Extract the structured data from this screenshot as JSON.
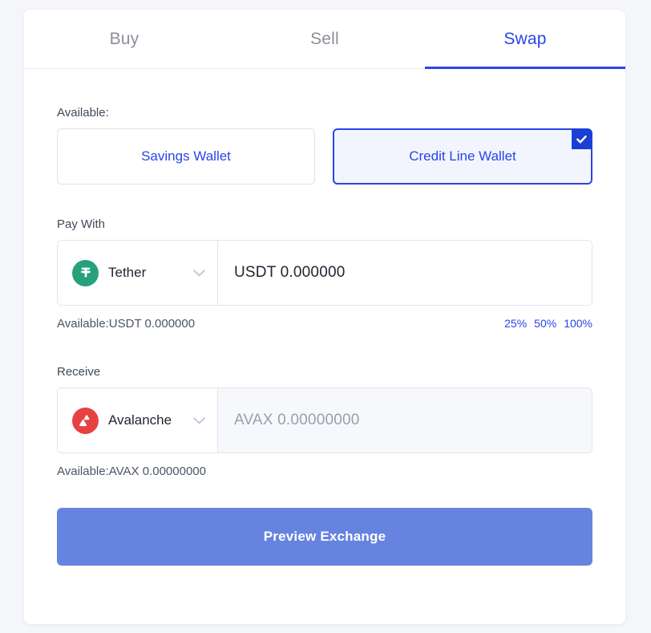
{
  "tabs": [
    {
      "label": "Buy",
      "active": false
    },
    {
      "label": "Sell",
      "active": false
    },
    {
      "label": "Swap",
      "active": true
    }
  ],
  "available_section": {
    "label": "Available:",
    "wallets": [
      {
        "label": "Savings Wallet",
        "selected": false
      },
      {
        "label": "Credit Line Wallet",
        "selected": true
      }
    ]
  },
  "pay_with": {
    "label": "Pay With",
    "coin": {
      "name": "Tether",
      "symbol": "USDT",
      "icon": "tether-icon",
      "color": "#26a17b"
    },
    "amount_value": "USDT 0.000000",
    "amount_placeholder": "USDT 0.000000",
    "balance_text": "Available:USDT 0.000000",
    "percents": [
      "25%",
      "50%",
      "100%"
    ]
  },
  "receive": {
    "label": "Receive",
    "coin": {
      "name": "Avalanche",
      "symbol": "AVAX",
      "icon": "avalanche-icon",
      "color": "#e84142"
    },
    "amount_value": "",
    "amount_placeholder": "AVAX 0.00000000",
    "balance_text": "Available:AVAX 0.00000000"
  },
  "submit": {
    "label": "Preview Exchange",
    "color": "#6683e0"
  },
  "theme": {
    "accent": "#2945e6",
    "page_bg": "#f4f6fa",
    "card_bg": "#ffffff"
  }
}
